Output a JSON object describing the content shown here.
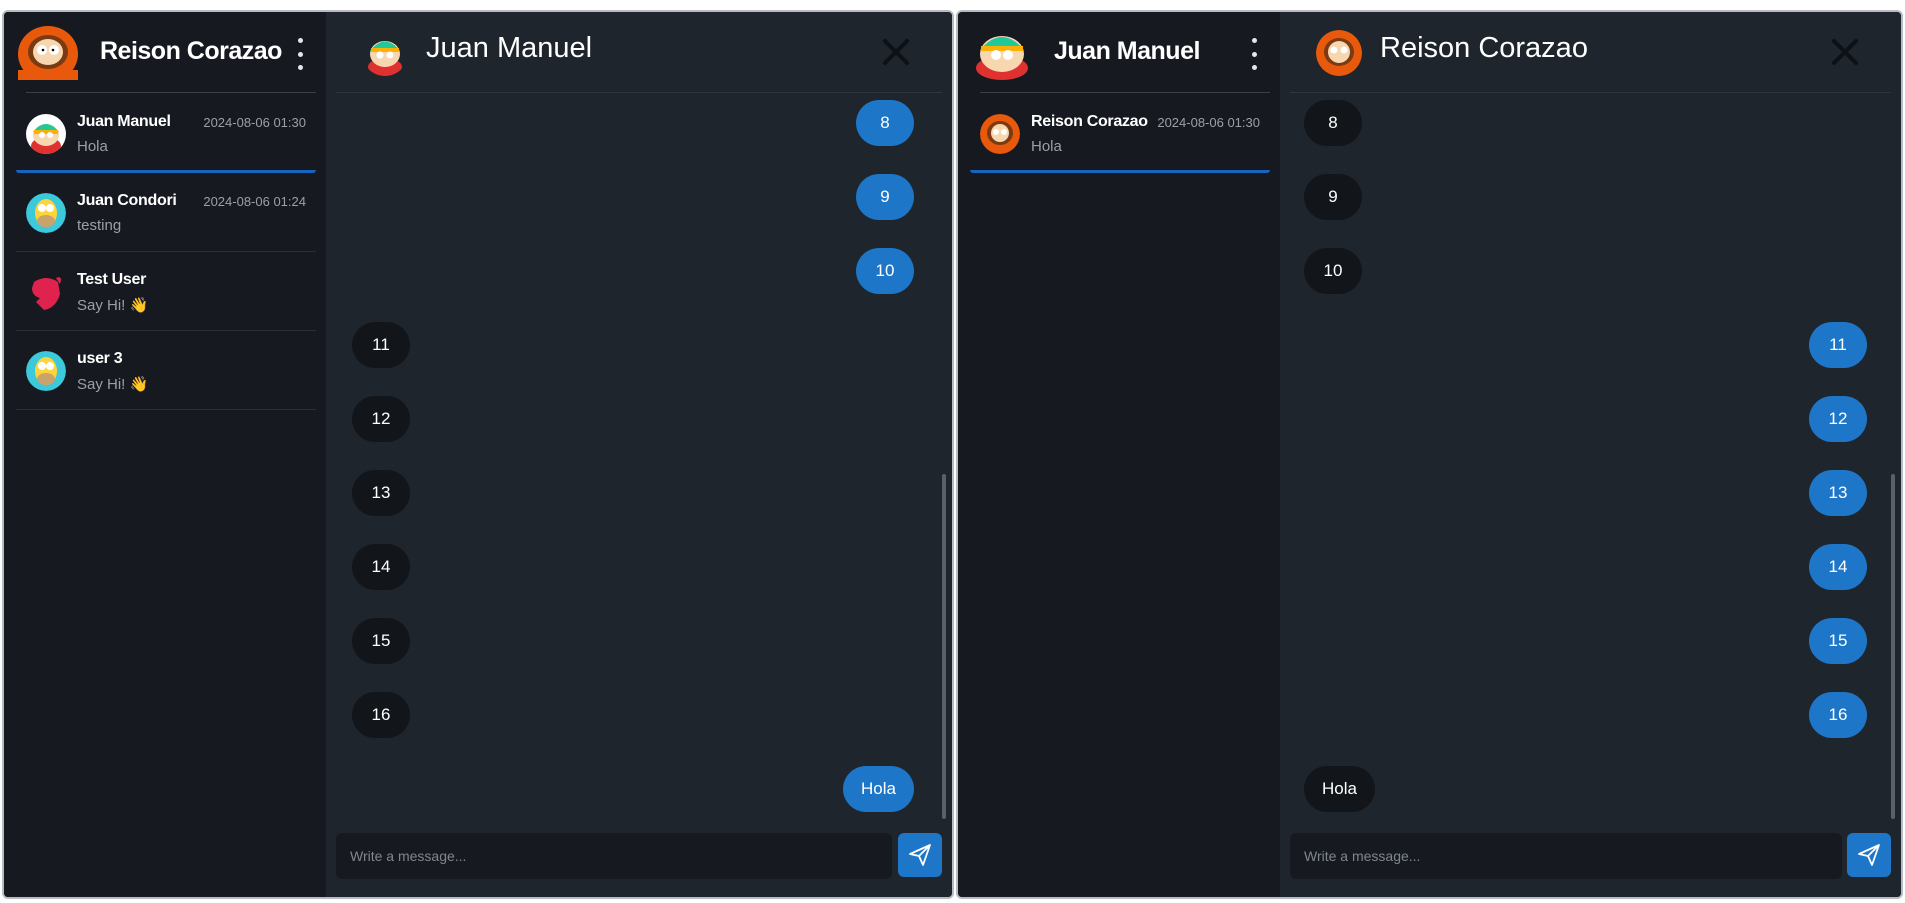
{
  "windows": [
    {
      "sidebar": {
        "user_name": "Reison Corazao",
        "user_avatar": "kenny-avatar",
        "conversations": [
          {
            "name": "Juan Manuel",
            "time": "2024-08-06 01:30",
            "preview": "Hola",
            "avatar": "cartman-avatar",
            "active": true
          },
          {
            "name": "Juan Condori",
            "time": "2024-08-06 01:24",
            "preview": "testing",
            "avatar": "homer-avatar",
            "active": false
          },
          {
            "name": "Test User",
            "time": "",
            "preview": "Say Hi! 👋",
            "avatar": "nest-logo-avatar",
            "active": false
          },
          {
            "name": "user 3",
            "time": "",
            "preview": "Say Hi! 👋",
            "avatar": "homer-avatar",
            "active": false
          }
        ]
      },
      "chat": {
        "title": "Juan Manuel",
        "avatar": "cartman-avatar",
        "messages": [
          {
            "text": "8",
            "direction": "out"
          },
          {
            "text": "9",
            "direction": "out"
          },
          {
            "text": "10",
            "direction": "out"
          },
          {
            "text": "11",
            "direction": "in"
          },
          {
            "text": "12",
            "direction": "in"
          },
          {
            "text": "13",
            "direction": "in"
          },
          {
            "text": "14",
            "direction": "in"
          },
          {
            "text": "15",
            "direction": "in"
          },
          {
            "text": "16",
            "direction": "in"
          },
          {
            "text": "Hola",
            "direction": "out"
          }
        ],
        "input_placeholder": "Write a message...",
        "input_value": ""
      }
    },
    {
      "sidebar": {
        "user_name": "Juan Manuel",
        "user_avatar": "cartman-avatar",
        "conversations": [
          {
            "name": "Reison Corazao",
            "time": "2024-08-06 01:30",
            "preview": "Hola",
            "avatar": "kenny-avatar",
            "active": true
          }
        ]
      },
      "chat": {
        "title": "Reison Corazao",
        "avatar": "kenny-avatar",
        "messages": [
          {
            "text": "8",
            "direction": "in"
          },
          {
            "text": "9",
            "direction": "in"
          },
          {
            "text": "10",
            "direction": "in"
          },
          {
            "text": "11",
            "direction": "out"
          },
          {
            "text": "12",
            "direction": "out"
          },
          {
            "text": "13",
            "direction": "out"
          },
          {
            "text": "14",
            "direction": "out"
          },
          {
            "text": "15",
            "direction": "out"
          },
          {
            "text": "16",
            "direction": "out"
          },
          {
            "text": "Hola",
            "direction": "in"
          }
        ],
        "input_placeholder": "Write a message...",
        "input_value": ""
      }
    }
  ],
  "colors": {
    "sidebar_bg": "#161a20",
    "chat_bg": "#1e252d",
    "outgoing_bubble": "#1e76c8",
    "incoming_bubble": "#121519",
    "active_underline": "#1565c0"
  }
}
